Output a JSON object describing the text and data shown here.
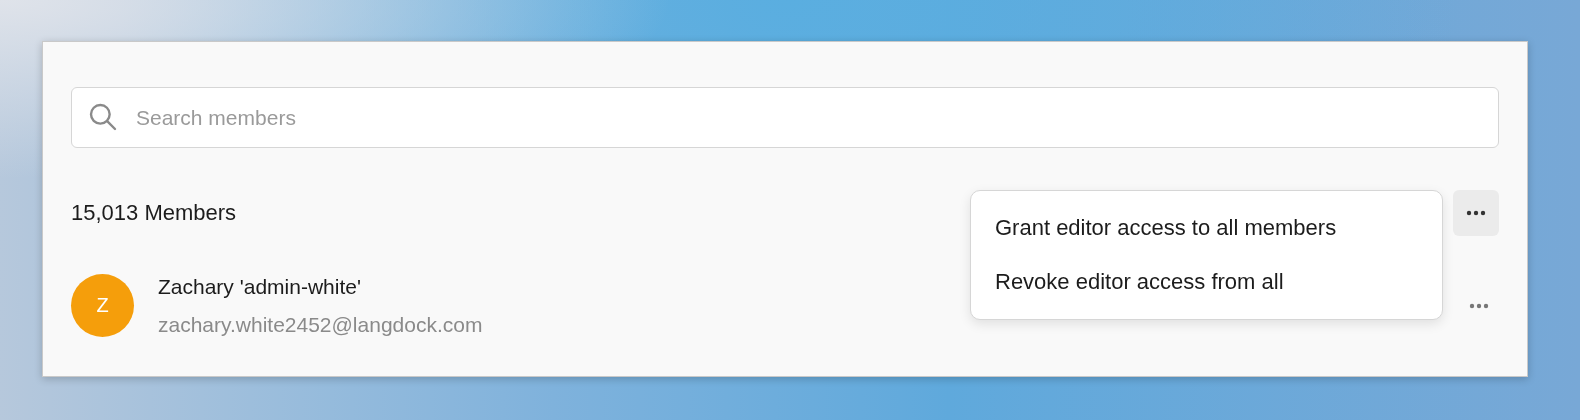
{
  "search": {
    "placeholder": "Search members"
  },
  "member_count": "15,013 Members",
  "more_button": {
    "selected": true
  },
  "menu": {
    "items": [
      {
        "label": "Grant editor access to all members"
      },
      {
        "label": "Revoke editor access from all"
      }
    ]
  },
  "members": [
    {
      "initial": "Z",
      "name": "Zachary 'admin-white'",
      "email": "zachary.white2452@langdock.com"
    }
  ]
}
